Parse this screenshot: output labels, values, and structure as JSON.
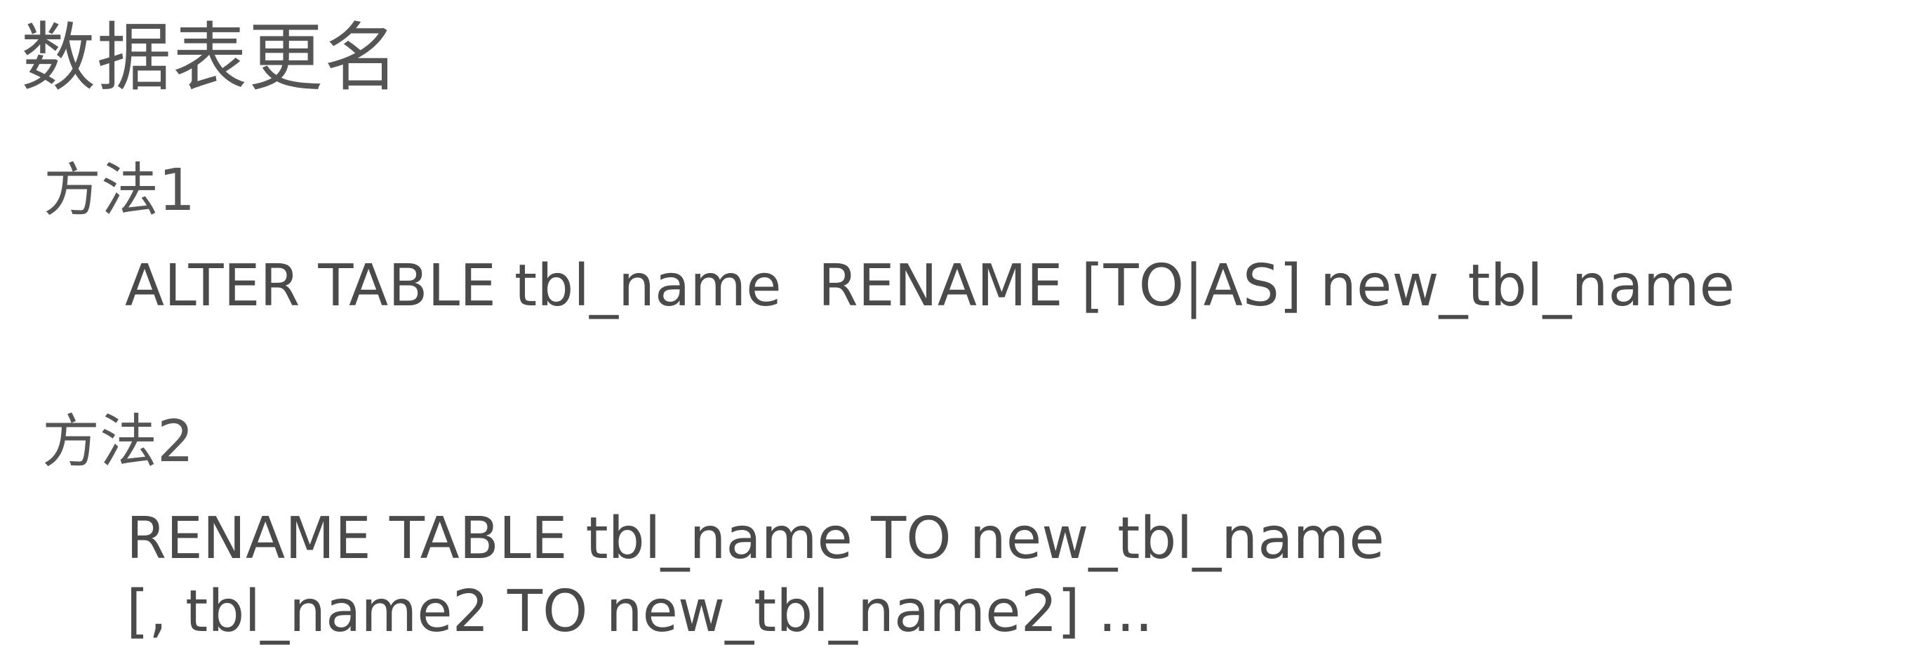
{
  "title": "数据表更名",
  "methods": [
    {
      "heading": "方法1",
      "lines": [
        "ALTER TABLE tbl_name  RENAME [TO|AS] new_tbl_name"
      ]
    },
    {
      "heading": "方法2",
      "lines": [
        "RENAME TABLE tbl_name TO new_tbl_name",
        "[, tbl_name2 TO new_tbl_name2] ..."
      ]
    }
  ]
}
